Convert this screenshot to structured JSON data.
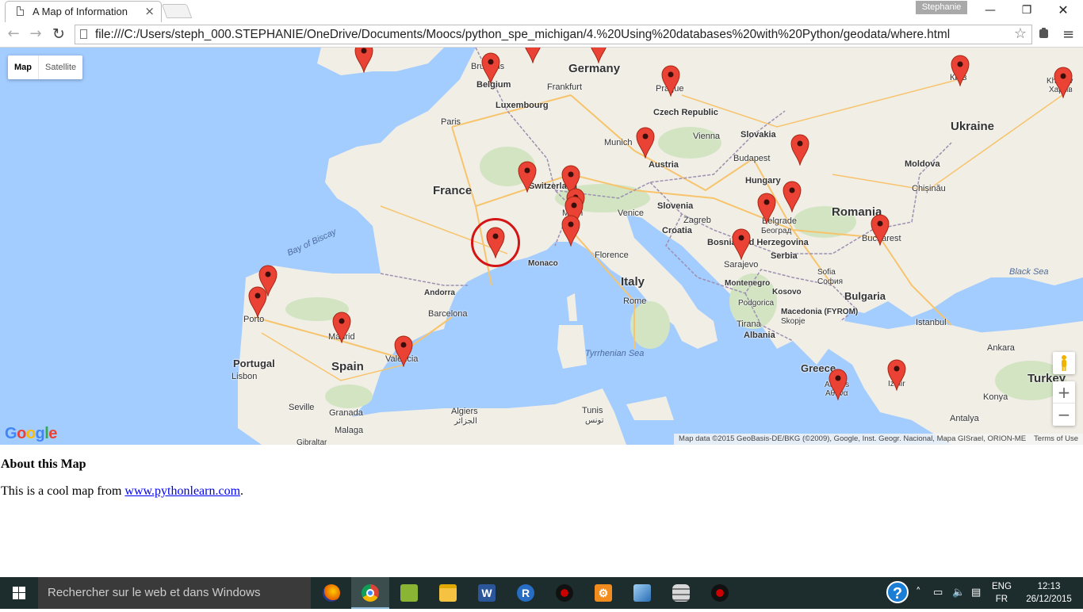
{
  "browser": {
    "tab_title": "A Map of Information",
    "tab_close": "×",
    "profile_name": "Stephanie",
    "window_controls": {
      "minimize": "—",
      "restore": "❐",
      "close": "✕"
    },
    "nav": {
      "back": "←",
      "forward": "→",
      "reload": "↻"
    },
    "url": "file:///C:/Users/steph_000.STEPHANIE/OneDrive/Documents/Moocs/python_spe_michigan/4.%20Using%20databases%20with%20Python/geodata/where.html",
    "star": "☆",
    "menu": "≡"
  },
  "map": {
    "type_control": {
      "map": "Map",
      "satellite": "Satellite"
    },
    "zoom_in": "+",
    "zoom_out": "−",
    "google_logo": [
      "G",
      "o",
      "o",
      "g",
      "l",
      "e"
    ],
    "attribution": "Map data ©2015 GeoBasis-DE/BKG (©2009), Google, Inst. Geogr. Nacional, Mapa GISrael, ORION-ME",
    "terms": "Terms of Use",
    "labels": {
      "germany": "Germany",
      "france": "France",
      "spain": "Spain",
      "portugal": "Portugal",
      "italy": "Italy",
      "ukraine": "Ukraine",
      "romania": "Romania",
      "bulgaria": "Bulgaria",
      "turkey": "Turkey",
      "greece": "Greece",
      "belgium": "Belgium",
      "luxembourg": "Luxembourg",
      "switzerland": "Switzerland",
      "austria": "Austria",
      "czech": "Czech Republic",
      "slovakia": "Slovakia",
      "hungary": "Hungary",
      "slovenia": "Slovenia",
      "croatia": "Croatia",
      "bosnia": "Bosnia and Herzegovina",
      "serbia": "Serbia",
      "montenegro": "Montenegro",
      "kosovo": "Kosovo",
      "macedonia": "Macedonia (FYROM)",
      "albania": "Albania",
      "moldova": "Moldova",
      "andorra": "Andorra",
      "monaco": "Monaco",
      "paris": "Paris",
      "frankfurt": "Frankfurt",
      "munich": "Munich",
      "prague": "Prague",
      "vienna": "Vienna",
      "budapest": "Budapest",
      "zagreb": "Zagreb",
      "belgrade": "Belgrade",
      "belgrade_cyr": "Београд",
      "bucharest": "Bucharest",
      "chisinau": "Chișinău",
      "kyiv": "Київ",
      "kharkiv": "Kharkiv",
      "kharkiv_cyr": "Харків",
      "venice": "Venice",
      "milan": "Milan",
      "florence": "Florence",
      "rome": "Rome",
      "sarajevo": "Sarajevo",
      "podgorica": "Podgorica",
      "tirana": "Tirana",
      "sofia": "Sofia",
      "sofia_cyr": "София",
      "skopje": "Skopje",
      "istanbul": "Istanbul",
      "ankara": "Ankara",
      "izmir": "Izmir",
      "konya": "Konya",
      "antalya": "Antalya",
      "athens": "Athens",
      "athens_gr": "Αθήνα",
      "barcelona": "Barcelona",
      "madrid": "Madrid",
      "valencia": "Valencia",
      "porto": "Porto",
      "lisbon": "Lisbon",
      "seville": "Seville",
      "granada": "Granada",
      "malaga": "Malaga",
      "gibraltar": "Gibraltar",
      "algiers": "Algiers",
      "algiers_ar": "الجزائر",
      "tunis": "Tunis",
      "tunis_ar": "تونس",
      "brussels": "Brussels",
      "bay_of_biscay": "Bay of Biscay",
      "tyrrhenian": "Tyrrhenian Sea",
      "black_sea": "Black Sea"
    }
  },
  "content": {
    "heading": "About this Map",
    "text_before": "This is a cool map from ",
    "link": "www.pythonlearn.com",
    "text_after": "."
  },
  "taskbar": {
    "search_placeholder": "Rechercher sur le web et dans Windows",
    "help": "?",
    "lang_line1": "ENG",
    "lang_line2": "FR",
    "time": "12:13",
    "date": "26/12/2015",
    "apps": [
      "firefox-icon",
      "chrome-icon",
      "sourcetree-icon",
      "file-explorer-icon",
      "word-icon",
      "r-icon",
      "spider-icon",
      "settings-app-icon",
      "virtualbox-icon",
      "database-icon",
      "spider2-icon"
    ],
    "colors": {
      "bar": "#1d2d2d",
      "active": "#3b4d4d"
    }
  },
  "colors": {
    "marker": "#ea4335",
    "highlight_circle": "#d41515",
    "sea": "#a3ccff",
    "land": "#f1eee6"
  }
}
